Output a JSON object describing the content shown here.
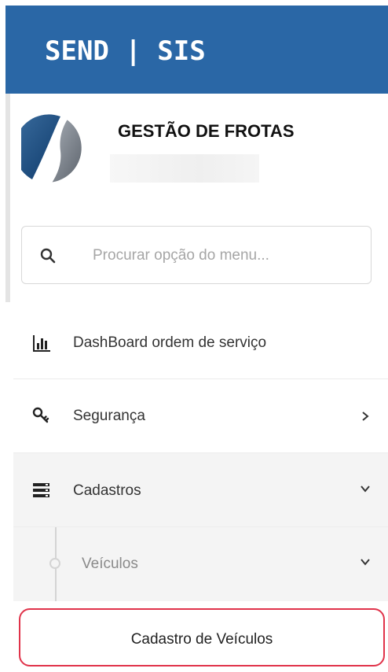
{
  "header": {
    "brand": "SEND | SIS"
  },
  "company": {
    "title": "GESTÃO DE FROTAS"
  },
  "search": {
    "placeholder": "Procurar opção do menu..."
  },
  "menu": [
    {
      "label": "DashBoard ordem de serviço",
      "icon": "bar-chart-icon"
    },
    {
      "label": "Segurança",
      "icon": "key-icon",
      "chevron": "right"
    },
    {
      "label": "Cadastros",
      "icon": "list-icon",
      "chevron": "down"
    }
  ],
  "submenu": {
    "label": "Veículos",
    "chevron": "down"
  },
  "highlight": {
    "label": "Cadastro de Veículos"
  },
  "colors": {
    "header": "#2a67a6",
    "highlight_border": "#e0334a"
  }
}
